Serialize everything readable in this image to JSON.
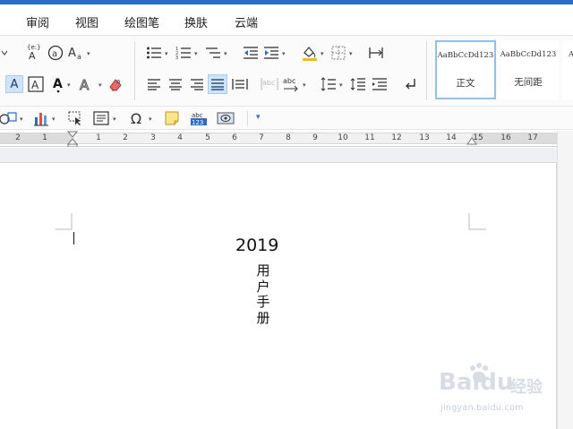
{
  "menu_tabs": [
    "审阅",
    "视图",
    "绘图笔",
    "换肤",
    "云端"
  ],
  "ribbon": {
    "font_glyphs": {
      "phonetic": "文",
      "phonetic_top": "wén",
      "enclosed": "㊀",
      "char_a": "A",
      "highlight_a": "A",
      "boxed_a": "A",
      "textfx_a": "A"
    },
    "styles": [
      {
        "sample": "AaBbCcDd123",
        "name": "正文",
        "selected": true
      },
      {
        "sample": "AaBbCcDd123",
        "name": "无间距",
        "selected": false
      },
      {
        "sample": "A",
        "name": "",
        "selected": false
      }
    ],
    "symbol_glyph": "Ω",
    "abc_label": "abc"
  },
  "ruler": {
    "left_numbers": [
      "2",
      "1"
    ],
    "right_numbers": [
      "1",
      "2",
      "3",
      "4",
      "5",
      "6",
      "7",
      "8",
      "9",
      "10",
      "11",
      "12",
      "13",
      "14",
      "15",
      "16",
      "17"
    ]
  },
  "document": {
    "year": "2019",
    "vertical_title": [
      "用",
      "户",
      "手",
      "册"
    ]
  },
  "watermark": {
    "brand": "Baidu",
    "brand_cn": "经验",
    "url": "jingyan.baidu.com"
  },
  "colors": {
    "accent": "#2b6cc4",
    "selected_style_border": "#8ec1f0",
    "highlight_button": "#cfe3fa"
  }
}
